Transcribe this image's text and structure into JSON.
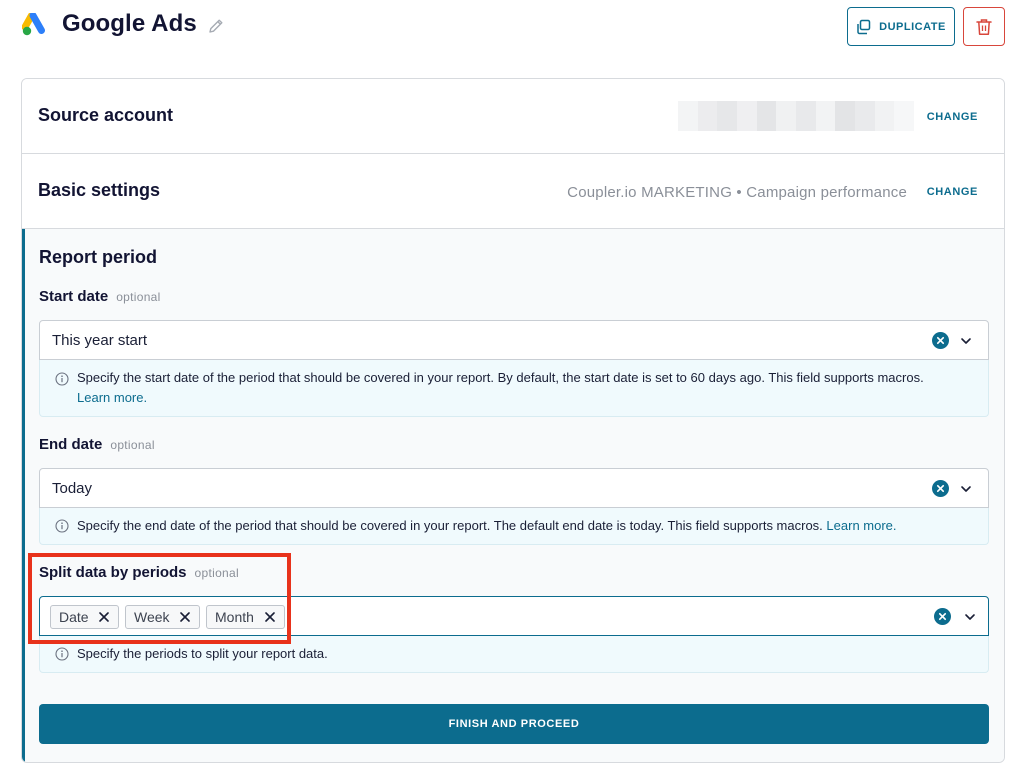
{
  "header": {
    "title": "Google Ads",
    "duplicate_label": "DUPLICATE"
  },
  "source_account": {
    "title": "Source account",
    "change_label": "CHANGE"
  },
  "basic_settings": {
    "title": "Basic settings",
    "value": "Coupler.io MARKETING • Campaign performance",
    "change_label": "CHANGE"
  },
  "report_period": {
    "title": "Report period",
    "start_date": {
      "label": "Start date",
      "optional": "optional",
      "value": "This year start",
      "hint": "Specify the start date of the period that should be covered in your report. By default, the start date is set to 60 days ago. This field supports macros.",
      "learn_more": "Learn more."
    },
    "end_date": {
      "label": "End date",
      "optional": "optional",
      "value": "Today",
      "hint": "Specify the end date of the period that should be covered in your report. The default end date is today. This field supports macros.",
      "learn_more": "Learn more."
    },
    "split": {
      "label": "Split data by periods",
      "optional": "optional",
      "tags": [
        "Date",
        "Week",
        "Month"
      ],
      "hint": "Specify the periods to split your report data."
    }
  },
  "finish_label": "FINISH AND PROCEED",
  "colors": {
    "accent": "#0c6c8e",
    "danger": "#d8463b",
    "highlight": "#e8321b"
  }
}
